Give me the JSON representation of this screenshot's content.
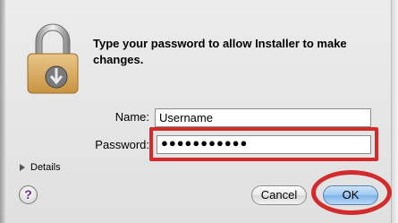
{
  "dialog": {
    "message": "Type your password to allow Installer to make changes.",
    "name_label": "Name:",
    "name_value": "Username",
    "password_label": "Password:",
    "password_value": "●●●●●●●●●●●",
    "details_label": "Details",
    "help_label": "?",
    "cancel_label": "Cancel",
    "ok_label": "OK"
  },
  "icons": {
    "lock": "padlock-with-installer-icon",
    "help": "help-icon",
    "disclosure": "disclosure-triangle-icon"
  },
  "colors": {
    "highlight": "#d32b2b",
    "default_button": "#8fbdee"
  }
}
